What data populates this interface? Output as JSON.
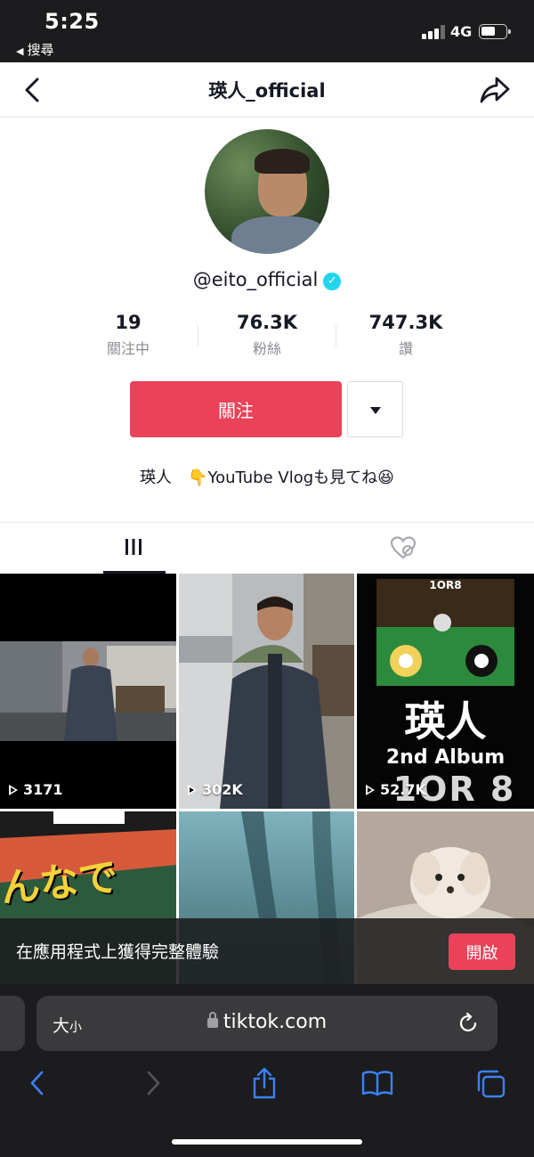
{
  "status_bar": {
    "time": "5:25",
    "back_app": "搜尋",
    "network": "4G"
  },
  "header": {
    "title": "瑛人_official"
  },
  "profile": {
    "username": "@eito_official",
    "stats": [
      {
        "value": "19",
        "label": "關注中"
      },
      {
        "value": "76.3K",
        "label": "粉絲"
      },
      {
        "value": "747.3K",
        "label": "讚"
      }
    ],
    "follow_label": "關注",
    "bio": "瑛人　👇YouTube Vlogも見てね😆"
  },
  "videos": [
    {
      "views": "3171"
    },
    {
      "views": "302K"
    },
    {
      "views": "52.7K",
      "cover_title": "瑛人",
      "cover_subtitle": "2nd Album",
      "cover_big": "1OR 8",
      "cover_top": "1OR8"
    },
    {
      "views": "",
      "cover_text": "んなで"
    },
    {
      "views": ""
    },
    {
      "views": ""
    }
  ],
  "banner": {
    "text": "在應用程式上獲得完整體驗",
    "open_label": "開啟"
  },
  "browser": {
    "text_size": "大",
    "text_size_small": "小",
    "url": "tiktok.com"
  },
  "colors": {
    "accent": "#ea4359",
    "verified": "#20d5ec"
  }
}
